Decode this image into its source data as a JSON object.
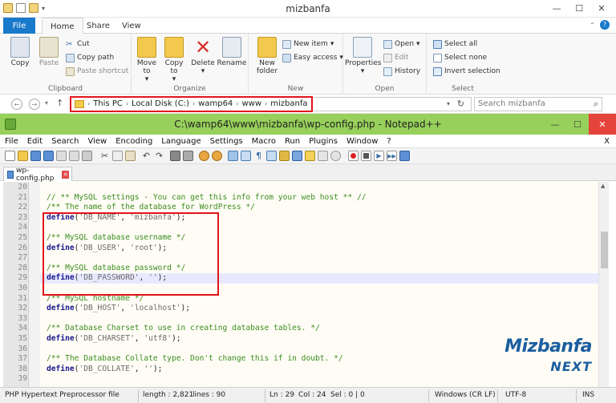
{
  "explorer": {
    "title": "mizbanfa",
    "tabs": [
      "File",
      "Home",
      "Share",
      "View"
    ],
    "ribbon": {
      "clipboard": {
        "label": "Clipboard",
        "copy": "Copy",
        "paste": "Paste",
        "cut": "Cut",
        "copy_path": "Copy path",
        "paste_shortcut": "Paste shortcut"
      },
      "organize": {
        "label": "Organize",
        "move_to": "Move to",
        "copy_to": "Copy to",
        "delete": "Delete",
        "rename": "Rename"
      },
      "new": {
        "label": "New",
        "new_folder": "New folder",
        "new_item": "New item",
        "easy_access": "Easy access"
      },
      "open": {
        "label": "Open",
        "properties": "Properties",
        "open": "Open",
        "edit": "Edit",
        "history": "History"
      },
      "select": {
        "label": "Select",
        "select_all": "Select all",
        "select_none": "Select none",
        "invert_selection": "Invert selection"
      }
    },
    "breadcrumb": [
      "This PC",
      "Local Disk (C:)",
      "wamp64",
      "www",
      "mizbanfa"
    ],
    "search_placeholder": "Search mizbanfa"
  },
  "notepad": {
    "title": "C:\\wamp64\\www\\mizbanfa\\wp-config.php - Notepad++",
    "menu": [
      "File",
      "Edit",
      "Search",
      "View",
      "Encoding",
      "Language",
      "Settings",
      "Macro",
      "Run",
      "Plugins",
      "Window",
      "?"
    ],
    "menu_close": "X",
    "tab": "wp-config.php",
    "lines": [
      {
        "n": "20",
        "parts": []
      },
      {
        "n": "21",
        "parts": [
          {
            "c": "cmt",
            "t": "// ** MySQL settings - You can get this info from your web host ** //"
          }
        ]
      },
      {
        "n": "22",
        "parts": [
          {
            "c": "cmt",
            "t": "/** The name of the database for WordPress */"
          }
        ]
      },
      {
        "n": "23",
        "parts": [
          {
            "c": "kw",
            "t": "define"
          },
          {
            "c": "pun",
            "t": "("
          },
          {
            "c": "str",
            "t": "'DB_NAME'"
          },
          {
            "c": "pun",
            "t": ", "
          },
          {
            "c": "str",
            "t": "'mizbanfa'"
          },
          {
            "c": "pun",
            "t": ");"
          }
        ]
      },
      {
        "n": "24",
        "parts": []
      },
      {
        "n": "25",
        "parts": [
          {
            "c": "cmt",
            "t": "/** MySQL database username */"
          }
        ]
      },
      {
        "n": "26",
        "parts": [
          {
            "c": "kw",
            "t": "define"
          },
          {
            "c": "pun",
            "t": "("
          },
          {
            "c": "str",
            "t": "'DB_USER'"
          },
          {
            "c": "pun",
            "t": ", "
          },
          {
            "c": "str",
            "t": "'root'"
          },
          {
            "c": "pun",
            "t": ");"
          }
        ]
      },
      {
        "n": "27",
        "parts": []
      },
      {
        "n": "28",
        "parts": [
          {
            "c": "cmt",
            "t": "/** MySQL database password */"
          }
        ]
      },
      {
        "n": "29",
        "parts": [
          {
            "c": "kw",
            "t": "define"
          },
          {
            "c": "pun",
            "t": "("
          },
          {
            "c": "str",
            "t": "'DB_PASSWORD'"
          },
          {
            "c": "pun",
            "t": ", "
          },
          {
            "c": "str",
            "t": "''"
          },
          {
            "c": "pun",
            "t": ");"
          }
        ]
      },
      {
        "n": "30",
        "parts": []
      },
      {
        "n": "31",
        "parts": [
          {
            "c": "cmt",
            "t": "/** MySQL hostname */"
          }
        ]
      },
      {
        "n": "32",
        "parts": [
          {
            "c": "kw",
            "t": "define"
          },
          {
            "c": "pun",
            "t": "("
          },
          {
            "c": "str",
            "t": "'DB_HOST'"
          },
          {
            "c": "pun",
            "t": ", "
          },
          {
            "c": "str",
            "t": "'localhost'"
          },
          {
            "c": "pun",
            "t": ");"
          }
        ]
      },
      {
        "n": "33",
        "parts": []
      },
      {
        "n": "34",
        "parts": [
          {
            "c": "cmt",
            "t": "/** Database Charset to use in creating database tables. */"
          }
        ]
      },
      {
        "n": "35",
        "parts": [
          {
            "c": "kw",
            "t": "define"
          },
          {
            "c": "pun",
            "t": "("
          },
          {
            "c": "str",
            "t": "'DB_CHARSET'"
          },
          {
            "c": "pun",
            "t": ", "
          },
          {
            "c": "str",
            "t": "'utf8'"
          },
          {
            "c": "pun",
            "t": ");"
          }
        ]
      },
      {
        "n": "36",
        "parts": []
      },
      {
        "n": "37",
        "parts": [
          {
            "c": "cmt",
            "t": "/** The Database Collate type. Don't change this if in doubt. */"
          }
        ]
      },
      {
        "n": "38",
        "parts": [
          {
            "c": "kw",
            "t": "define"
          },
          {
            "c": "pun",
            "t": "("
          },
          {
            "c": "str",
            "t": "'DB_COLLATE'"
          },
          {
            "c": "pun",
            "t": ", "
          },
          {
            "c": "str",
            "t": "''"
          },
          {
            "c": "pun",
            "t": ");"
          }
        ]
      },
      {
        "n": "39",
        "parts": []
      }
    ],
    "current_line": "29",
    "status": {
      "lang": "PHP Hypertext Preprocessor file",
      "length": "length : 2,821",
      "lines": "lines : 90",
      "ln": "Ln : 29",
      "col": "Col : 24",
      "sel": "Sel : 0 | 0",
      "eol": "Windows (CR LF)",
      "enc": "UTF-8",
      "ins": "INS"
    }
  },
  "watermark": {
    "line1": "Mizbanfa",
    "line2": "NEXT"
  },
  "colors": {
    "accent": "#1979ca",
    "npp_title": "#97d05a",
    "highlight": "#e2131b"
  }
}
